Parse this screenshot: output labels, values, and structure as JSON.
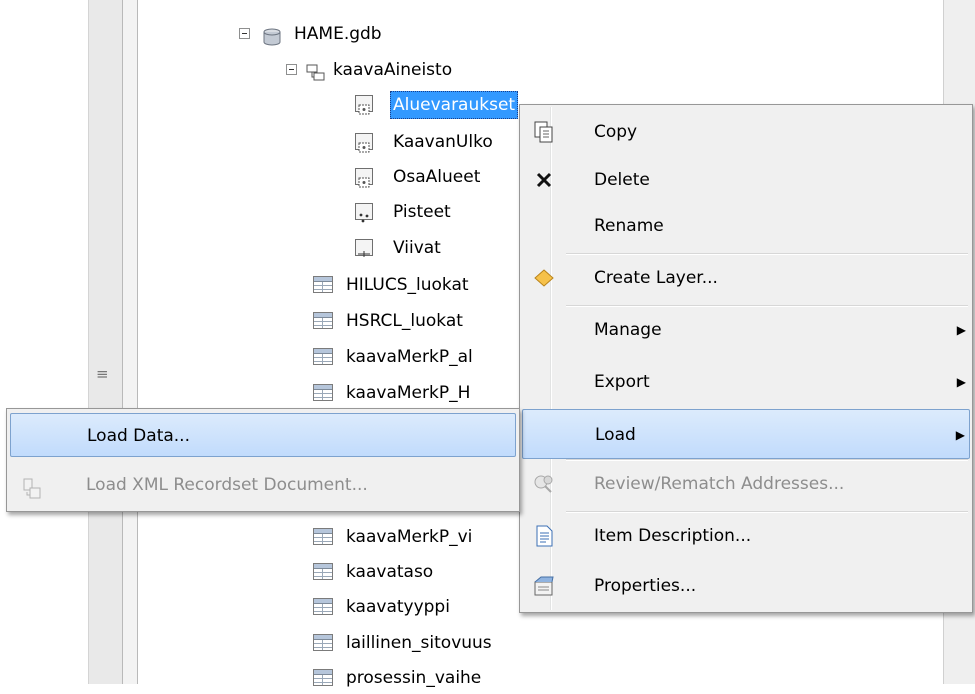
{
  "tree": {
    "gdb": {
      "label": "HAME.gdb",
      "icon": "geodatabase-icon"
    },
    "dataset": {
      "label": "kaavaAineisto",
      "icon": "feature-dataset-icon"
    },
    "dataset_items": [
      {
        "label": "Aluevaraukset",
        "icon": "polygon-feature-class-icon"
      },
      {
        "label": "KaavanUlko",
        "icon": "polygon-feature-class-icon"
      },
      {
        "label": "OsaAlueet",
        "icon": "polygon-feature-class-icon"
      },
      {
        "label": "Pisteet",
        "icon": "point-feature-class-icon"
      },
      {
        "label": "Viivat",
        "icon": "line-feature-class-icon"
      }
    ],
    "tables": [
      {
        "label": "HILUCS_luokat"
      },
      {
        "label": "HSRCL_luokat"
      },
      {
        "label": "kaavaMerkP_al"
      },
      {
        "label": "kaavaMerkP_H"
      },
      {
        "label": "kaavaMerkP_vi"
      },
      {
        "label": "kaavataso"
      },
      {
        "label": "kaavatyyppi"
      },
      {
        "label": "laillinen_sitovuus"
      },
      {
        "label": "prosessin_vaihe"
      }
    ],
    "grip_glyph": "≡"
  },
  "context_menu": {
    "items": [
      {
        "label": "Copy",
        "icon": "copy-icon"
      },
      {
        "label": "Delete",
        "icon": "delete-icon"
      },
      {
        "label": "Rename",
        "icon": ""
      },
      {
        "label": "Create Layer...",
        "icon": "create-layer-icon"
      },
      {
        "label": "Manage",
        "icon": "",
        "submenu": true
      },
      {
        "label": "Export",
        "icon": "",
        "submenu": true
      },
      {
        "label": "Load",
        "icon": "",
        "submenu": true,
        "highlighted": true
      },
      {
        "label": "Review/Rematch Addresses...",
        "icon": "review-rematch-icon",
        "disabled": true
      },
      {
        "label": "Item Description...",
        "icon": "item-description-icon"
      },
      {
        "label": "Properties...",
        "icon": "properties-icon"
      }
    ],
    "arrow_glyph": "▶"
  },
  "load_submenu": {
    "items": [
      {
        "label": "Load Data...",
        "highlighted": true
      },
      {
        "label": "Load XML Recordset Document...",
        "disabled": true,
        "icon": "load-xml-icon"
      }
    ]
  },
  "colors": {
    "selection": "#3399ff",
    "menu_bg": "#f0f0f0",
    "highlight": "#c1dbfc"
  }
}
